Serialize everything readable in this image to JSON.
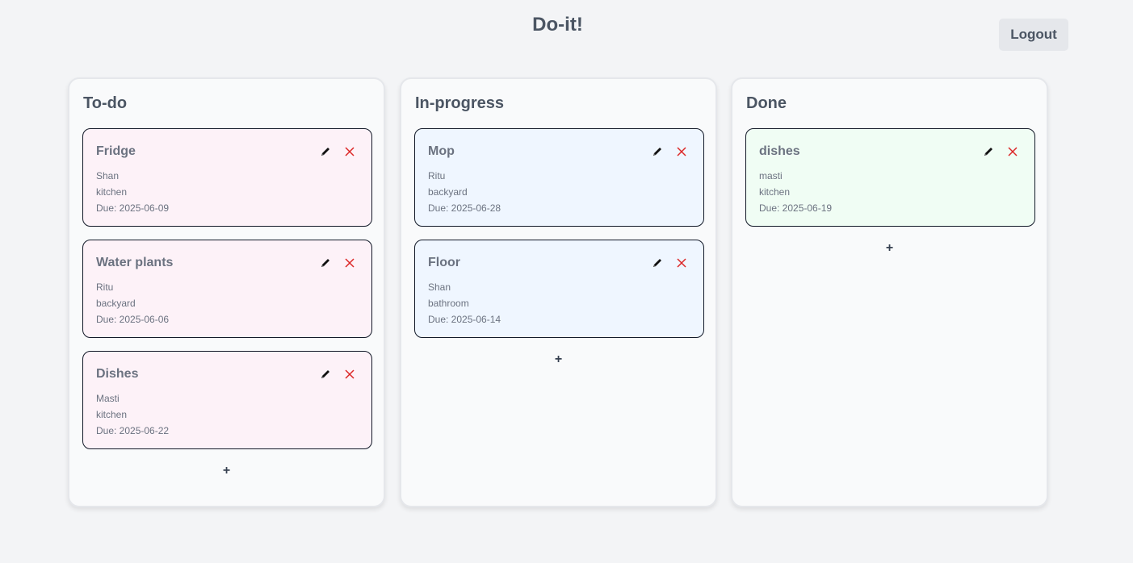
{
  "app": {
    "title": "Do-it!",
    "logout_label": "Logout"
  },
  "columns": [
    {
      "title": "To-do",
      "cards": [
        {
          "title": "Fridge",
          "person": "Shan",
          "location": "kitchen",
          "due": "Due: 2025-06-09"
        },
        {
          "title": "Water plants",
          "person": "Ritu",
          "location": "backyard",
          "due": "Due: 2025-06-06"
        },
        {
          "title": "Dishes",
          "person": "Masti",
          "location": "kitchen",
          "due": "Due: 2025-06-22"
        }
      ],
      "add_label": "+"
    },
    {
      "title": "In-progress",
      "cards": [
        {
          "title": "Mop",
          "person": "Ritu",
          "location": "backyard",
          "due": "Due: 2025-06-28"
        },
        {
          "title": "Floor",
          "person": "Shan",
          "location": "bathroom",
          "due": "Due: 2025-06-14"
        }
      ],
      "add_label": "+"
    },
    {
      "title": "Done",
      "cards": [
        {
          "title": "dishes",
          "person": "masti",
          "location": "kitchen",
          "due": "Due: 2025-06-19"
        }
      ],
      "add_label": "+"
    }
  ],
  "icons": {
    "edit": "pencil-icon",
    "delete": "close-icon"
  },
  "colors": {
    "todo_card": "#fdf2f8",
    "progress_card": "#eff6ff",
    "done_card": "#f0fdf4",
    "delete_icon": "#dc2626"
  }
}
